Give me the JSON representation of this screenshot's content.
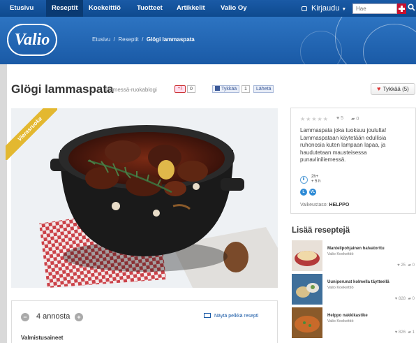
{
  "nav": {
    "items": [
      "Etusivu",
      "Reseptit",
      "Koekeittiö",
      "Tuotteet",
      "Artikkelit",
      "Valio Oy"
    ],
    "active": "Reseptit",
    "login_label": "Kirjaudu",
    "search_placeholder": "Hae"
  },
  "brand": {
    "logo_text": "Valio",
    "breadcrumb": [
      "Etusivu",
      "Reseptit",
      "Glögi lammaspata"
    ]
  },
  "recipe": {
    "title": "Glögi lammaspata",
    "category": "Liemessä-ruokablogi",
    "gplus_label": "+1",
    "gplus_count": "0",
    "fb_like": "Tykkää",
    "fb_count": "1",
    "fb_send": "Lähetä",
    "like_button": "Tykkää (5)",
    "ribbon": "Vierasruoka",
    "rating_stars": "★★★★★",
    "likes": "5",
    "comments": "0",
    "description": "Lammaspata joka tuoksuu joululta! Lammaspataan käytetään edullisia ruhonosia kuten lampaan lapaa, ja haudutetaan mausteisessa punaviiniliemessä.",
    "time_line1": "2h+",
    "time_line2": "+ 5 h",
    "diet_badges": [
      "L",
      "VL"
    ],
    "difficulty_label": "Vaikeustaso:",
    "difficulty_value": "HELPPO",
    "servings": "4 annosta",
    "servings_minus": "−",
    "servings_plus": "+",
    "plain_recipe": "Näytä pelkkä resepti",
    "ingredients_heading": "Valmistusaineet"
  },
  "more_recipes": {
    "heading": "Lisää reseptejä",
    "items": [
      {
        "title": "Mantelipohjainen halvatorttu",
        "author": "Valio Koekeittiö",
        "likes": "25",
        "comments": "0",
        "color": "#b43a3a"
      },
      {
        "title": "Uuniperunat kolmella täytteellä",
        "author": "Valio Koekeittiö",
        "likes": "828",
        "comments": "0",
        "color": "#3f6f9a"
      },
      {
        "title": "Helppo nakkikastike",
        "author": "Valio Koekeittiö",
        "likes": "826",
        "comments": "1",
        "color": "#8a5a2a"
      }
    ]
  },
  "colors": {
    "nav_bg": "#1a5aa6",
    "brand_bg": "#2d74c2",
    "ribbon": "#e3b830",
    "link": "#1a5aa6"
  }
}
